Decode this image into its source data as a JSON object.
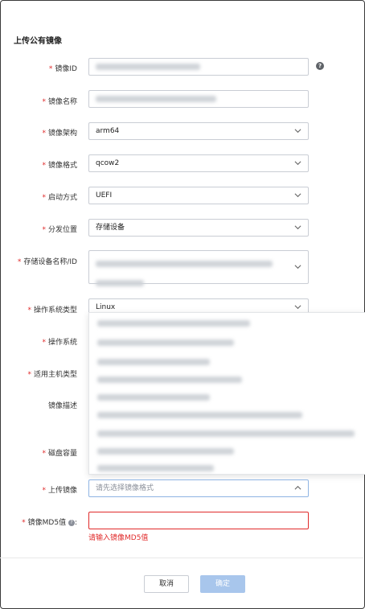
{
  "dialog": {
    "title": "上传公有镜像"
  },
  "form": {
    "image_id": {
      "label": "镜像ID",
      "required": true
    },
    "image_name": {
      "label": "镜像名称",
      "required": true
    },
    "image_arch": {
      "label": "镜像架构",
      "required": true,
      "value": "arm64"
    },
    "image_format": {
      "label": "镜像格式",
      "required": true,
      "value": "qcow2"
    },
    "boot_mode": {
      "label": "启动方式",
      "required": true,
      "value": "UEFI"
    },
    "distribution": {
      "label": "分发位置",
      "required": true,
      "value": "存储设备"
    },
    "storage_device": {
      "label": "存储设备名称/ID",
      "required": true
    },
    "os_type": {
      "label": "操作系统类型",
      "required": true,
      "value": "Linux"
    },
    "os": {
      "label": "操作系统",
      "required": true
    },
    "host_type": {
      "label": "适用主机类型",
      "required": true
    },
    "description": {
      "label": "镜像描述",
      "required": false
    },
    "disk_capacity": {
      "label": "磁盘容量",
      "required": true
    },
    "upload_image": {
      "label": "上传镜像",
      "required": true,
      "placeholder": "请先选择镜像格式"
    },
    "md5": {
      "label": "镜像MD5值",
      "required": true,
      "suffix": ":",
      "error": "请输入镜像MD5值"
    }
  },
  "buttons": {
    "cancel": "取消",
    "ok": "确定"
  },
  "icons": {
    "help": "question-circle-icon",
    "chevron": "chevron-down-icon",
    "chevron_up": "chevron-up-icon"
  },
  "colors": {
    "required": "#e02a2a",
    "primary_disabled": "#a8c6ec",
    "error_border": "#e02a2a"
  }
}
